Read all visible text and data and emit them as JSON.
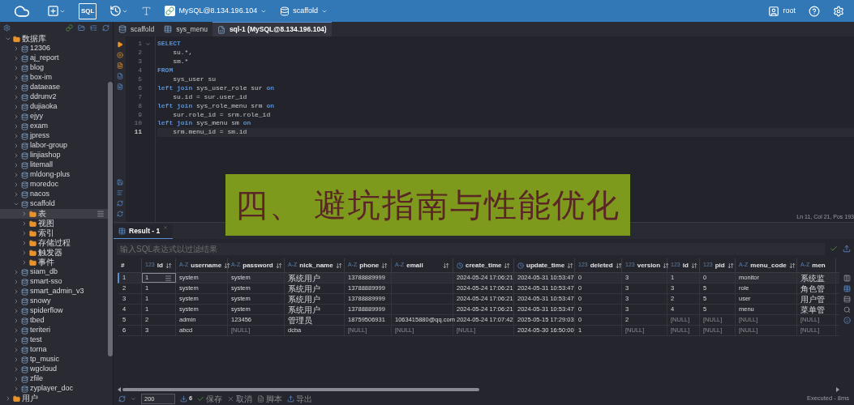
{
  "toolbar": {
    "sql_label": "SQL",
    "connection": "MySQL@8.134.196.104",
    "database": "scaffold",
    "user": "root"
  },
  "tree": {
    "label": "数据库",
    "kind": "folder",
    "expanded": true,
    "selected": false,
    "children": [
      {
        "label": "12306",
        "kind": "database",
        "expanded": false,
        "selected": false
      },
      {
        "label": "aj_report",
        "kind": "database",
        "expanded": false,
        "selected": false
      },
      {
        "label": "blog",
        "kind": "database",
        "expanded": false,
        "selected": false
      },
      {
        "label": "box-im",
        "kind": "database",
        "expanded": false,
        "selected": false
      },
      {
        "label": "dataease",
        "kind": "database",
        "expanded": false,
        "selected": false
      },
      {
        "label": "ddrunv2",
        "kind": "database",
        "expanded": false,
        "selected": false
      },
      {
        "label": "dujiaoka",
        "kind": "database",
        "expanded": false,
        "selected": false
      },
      {
        "label": "ejyy",
        "kind": "database",
        "expanded": false,
        "selected": false
      },
      {
        "label": "exam",
        "kind": "database",
        "expanded": false,
        "selected": false
      },
      {
        "label": "jpress",
        "kind": "database",
        "expanded": false,
        "selected": false
      },
      {
        "label": "labor-group",
        "kind": "database",
        "expanded": false,
        "selected": false
      },
      {
        "label": "linjiashop",
        "kind": "database",
        "expanded": false,
        "selected": false
      },
      {
        "label": "litemall",
        "kind": "database",
        "expanded": false,
        "selected": false
      },
      {
        "label": "mldong-plus",
        "kind": "database",
        "expanded": false,
        "selected": false
      },
      {
        "label": "moredoc",
        "kind": "database",
        "expanded": false,
        "selected": false
      },
      {
        "label": "nacos",
        "kind": "database",
        "expanded": false,
        "selected": false
      },
      {
        "label": "scaffold",
        "kind": "database",
        "expanded": true,
        "selected": false,
        "children": [
          {
            "label": "表",
            "kind": "folder",
            "expanded": false,
            "selected": true
          },
          {
            "label": "视图",
            "kind": "folder",
            "expanded": false,
            "selected": false
          },
          {
            "label": "索引",
            "kind": "folder",
            "expanded": false,
            "selected": false
          },
          {
            "label": "存储过程",
            "kind": "folder",
            "expanded": false,
            "selected": false
          },
          {
            "label": "触发器",
            "kind": "folder",
            "expanded": false,
            "selected": false
          },
          {
            "label": "事件",
            "kind": "folder",
            "expanded": false,
            "selected": false
          }
        ]
      },
      {
        "label": "siam_db",
        "kind": "database",
        "expanded": false,
        "selected": false
      },
      {
        "label": "smart-sso",
        "kind": "database",
        "expanded": false,
        "selected": false
      },
      {
        "label": "smart_admin_v3",
        "kind": "database",
        "expanded": false,
        "selected": false
      },
      {
        "label": "snowy",
        "kind": "database",
        "expanded": false,
        "selected": false
      },
      {
        "label": "spiderflow",
        "kind": "database",
        "expanded": false,
        "selected": false
      },
      {
        "label": "tbed",
        "kind": "database",
        "expanded": false,
        "selected": false
      },
      {
        "label": "teriteri",
        "kind": "database",
        "expanded": false,
        "selected": false
      },
      {
        "label": "test",
        "kind": "database",
        "expanded": false,
        "selected": false
      },
      {
        "label": "torna",
        "kind": "database",
        "expanded": false,
        "selected": false
      },
      {
        "label": "tp_music",
        "kind": "database",
        "expanded": false,
        "selected": false
      },
      {
        "label": "wgcloud",
        "kind": "database",
        "expanded": false,
        "selected": false
      },
      {
        "label": "zfile",
        "kind": "database",
        "expanded": false,
        "selected": false
      },
      {
        "label": "zyplayer_doc",
        "kind": "database",
        "expanded": false,
        "selected": false
      }
    ]
  },
  "tree_extra": [
    {
      "label": "用户",
      "kind": "folder",
      "expanded": false,
      "selected": false
    }
  ],
  "editor_tabs": [
    {
      "label": "scaffold",
      "kind": "database",
      "selected": false
    },
    {
      "label": "sys_menu",
      "kind": "table",
      "selected": false
    },
    {
      "label": "sql-1 (MySQL@8.134.196.104)",
      "kind": "script",
      "selected": true
    }
  ],
  "code": [
    {
      "number": "1",
      "foldable": true,
      "tokens": [
        {
          "t": "SELECT",
          "kind": "keyword"
        }
      ]
    },
    {
      "number": "2",
      "foldable": false,
      "tokens": [
        {
          "t": "    su.*,",
          "kind": "plain"
        }
      ]
    },
    {
      "number": "3",
      "foldable": false,
      "tokens": [
        {
          "t": "    sm.*",
          "kind": "plain"
        }
      ]
    },
    {
      "number": "4",
      "foldable": false,
      "tokens": [
        {
          "t": "FROM",
          "kind": "keyword"
        }
      ]
    },
    {
      "number": "5",
      "foldable": false,
      "tokens": [
        {
          "t": "    sys_user su",
          "kind": "plain"
        }
      ]
    },
    {
      "number": "6",
      "foldable": false,
      "tokens": [
        {
          "t": "left join",
          "kind": "keyword"
        },
        {
          "t": " sys_user_role sur ",
          "kind": "plain"
        },
        {
          "t": "on",
          "kind": "keyword"
        }
      ]
    },
    {
      "number": "7",
      "foldable": false,
      "tokens": [
        {
          "t": "    su.id = sur.user_id",
          "kind": "plain"
        }
      ]
    },
    {
      "number": "8",
      "foldable": false,
      "tokens": [
        {
          "t": "left join",
          "kind": "keyword"
        },
        {
          "t": " sys_role_menu srm ",
          "kind": "plain"
        },
        {
          "t": "on",
          "kind": "keyword"
        }
      ]
    },
    {
      "number": "9",
      "foldable": false,
      "tokens": [
        {
          "t": "    sur.role_id = srm.role_id",
          "kind": "plain"
        }
      ]
    },
    {
      "number": "10",
      "foldable": false,
      "tokens": [
        {
          "t": "left join",
          "kind": "keyword"
        },
        {
          "t": " sys_menu sm ",
          "kind": "plain"
        },
        {
          "t": "on",
          "kind": "keyword"
        }
      ]
    },
    {
      "number": "11",
      "foldable": false,
      "tokens": [
        {
          "t": "    srm.menu_id = sm.id",
          "kind": "plain"
        }
      ]
    }
  ],
  "editor_status": "Ln 11, Col 21, Pos 193",
  "banner": "四、 避坑指南与性能优化",
  "result_tab": {
    "label": "Result - 1",
    "selected": true
  },
  "filter": {
    "placeholder": "输入SQL表达式以过滤结果"
  },
  "columns": [
    {
      "name": "#",
      "kind": "index"
    },
    {
      "name": "id",
      "kind": "number",
      "type_label": "123"
    },
    {
      "name": "username",
      "kind": "text",
      "type_label": "A-Z"
    },
    {
      "name": "password",
      "kind": "text",
      "type_label": "A-Z"
    },
    {
      "name": "nick_name",
      "kind": "text",
      "type_label": "A-Z"
    },
    {
      "name": "phone",
      "kind": "text",
      "type_label": "A-Z"
    },
    {
      "name": "email",
      "kind": "text",
      "type_label": "A-Z"
    },
    {
      "name": "create_time",
      "kind": "datetime"
    },
    {
      "name": "update_time",
      "kind": "datetime"
    },
    {
      "name": "deleted",
      "kind": "number",
      "type_label": "123"
    },
    {
      "name": "version",
      "kind": "number",
      "type_label": "123"
    },
    {
      "name": "id",
      "kind": "number",
      "type_label": "123"
    },
    {
      "name": "pid",
      "kind": "number",
      "type_label": "123"
    },
    {
      "name": "menu_code",
      "kind": "text",
      "type_label": "A-Z"
    },
    {
      "name": "men",
      "kind": "text",
      "type_label": "A-Z"
    }
  ],
  "rows": [
    {
      "selected": true,
      "cells": [
        "1",
        "1",
        "system",
        "system",
        "系统用户",
        "13788889999",
        "",
        "2024-05-24 17:06:21",
        "2024-05-31 10:53:47",
        "0",
        "3",
        "1",
        "0",
        "monitor",
        "系统监"
      ]
    },
    {
      "selected": false,
      "cells": [
        "2",
        "1",
        "system",
        "system",
        "系统用户",
        "13788889999",
        "",
        "2024-05-24 17:06:21",
        "2024-05-31 10:53:47",
        "0",
        "3",
        "3",
        "5",
        "role",
        "角色管"
      ]
    },
    {
      "selected": false,
      "cells": [
        "3",
        "1",
        "system",
        "system",
        "系统用户",
        "13788889999",
        "",
        "2024-05-24 17:06:21",
        "2024-05-31 10:53:47",
        "0",
        "3",
        "2",
        "5",
        "user",
        "用户管"
      ]
    },
    {
      "selected": false,
      "cells": [
        "4",
        "1",
        "system",
        "system",
        "系统用户",
        "13788889999",
        "",
        "2024-05-24 17:06:21",
        "2024-05-31 10:53:47",
        "0",
        "3",
        "4",
        "5",
        "menu",
        "菜单管"
      ]
    },
    {
      "selected": false,
      "cells": [
        "5",
        "2",
        "admin",
        "123456",
        "管理员",
        "18759506931",
        "1063415880@qq.com",
        "2024-05-24 17:07:42",
        "2025-05-15 17:29:03",
        "0",
        "2",
        "[NULL]",
        "[NULL]",
        "[NULL]",
        "[NULL]"
      ]
    },
    {
      "selected": false,
      "cells": [
        "6",
        "3",
        "abcd",
        "[NULL]",
        "dcba",
        "[NULL]",
        "[NULL]",
        "[NULL]",
        "2024-05-30 16:50:00",
        "1",
        "[NULL]",
        "[NULL]",
        "[NULL]",
        "[NULL]",
        "[NULL]"
      ]
    }
  ],
  "bottom_bar": {
    "limit": "200",
    "row_count": "6",
    "actions": [
      {
        "label": "保存",
        "kind": "save"
      },
      {
        "label": "取消",
        "kind": "cancel"
      },
      {
        "label": "脚本",
        "kind": "script"
      },
      {
        "label": "导出",
        "kind": "export"
      }
    ],
    "status": "Executed - 8ms"
  }
}
